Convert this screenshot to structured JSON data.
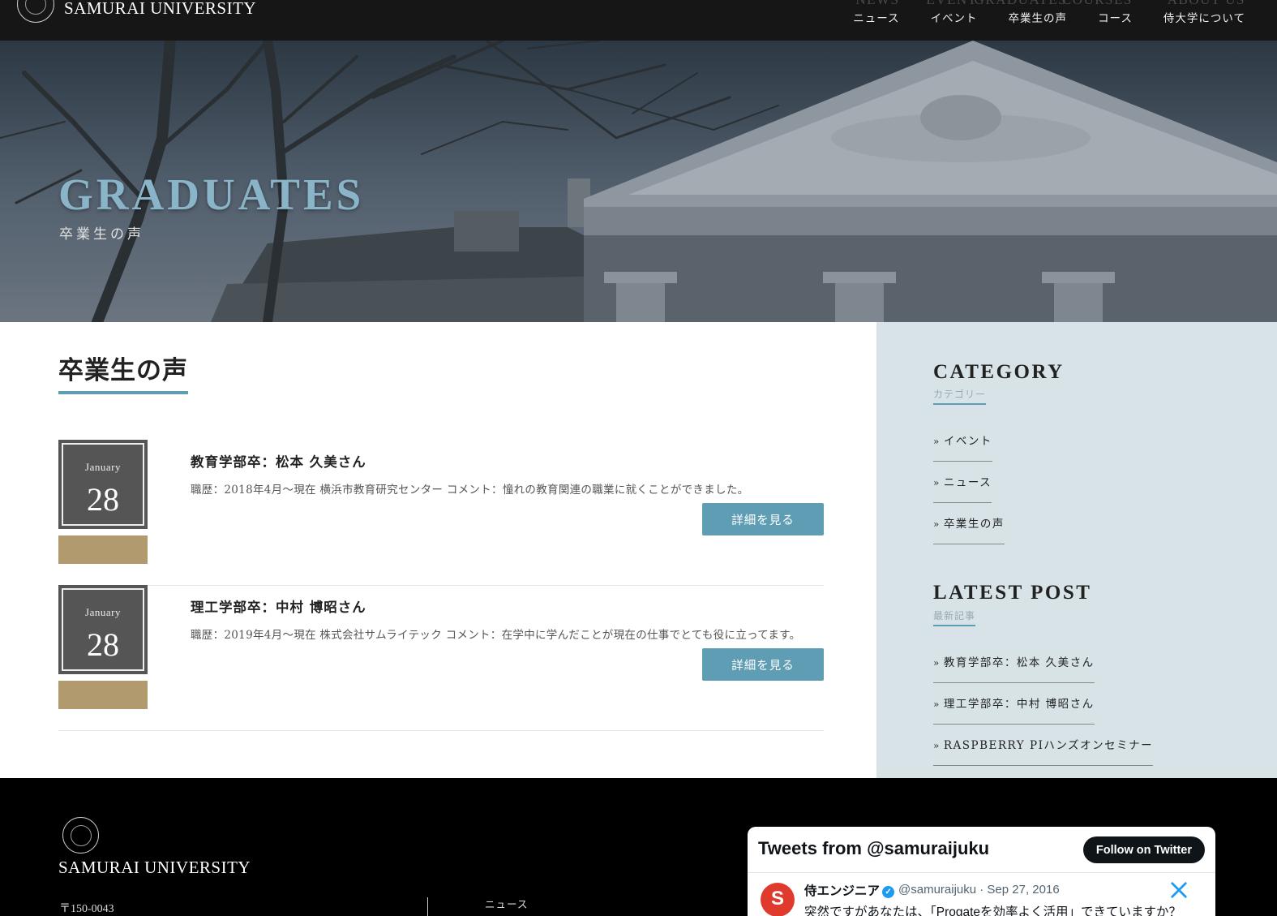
{
  "header": {
    "logo_text": "SAMURAI UNIVERSITY",
    "nav": [
      {
        "en": "NEWS",
        "ja": "ニュース"
      },
      {
        "en": "EVENT",
        "ja": "イベント"
      },
      {
        "en": "GRADUATES",
        "ja": "卒業生の声"
      },
      {
        "en": "COURSES",
        "ja": "コース"
      },
      {
        "en": "ABOUT US",
        "ja": "侍大学について"
      }
    ]
  },
  "hero": {
    "title": "GRADUATES",
    "subtitle": "卒業生の声"
  },
  "main": {
    "heading": "卒業生の声",
    "posts": [
      {
        "month": "January",
        "day": "28",
        "title": "教育学部卒：松本 久美さん",
        "description": "職歴：2018年4月～現在 横浜市教育研究センター コメント：憧れの教育関連の職業に就くことができました。",
        "button": "詳細を見る"
      },
      {
        "month": "January",
        "day": "28",
        "title": "理工学部卒：中村 博昭さん",
        "description": "職歴：2019年4月～現在 株式会社サムライテック コメント：在学中に学んだことが現在の仕事でとても役に立ってます。",
        "button": "詳細を見る"
      }
    ]
  },
  "sidebar": {
    "category": {
      "title": "CATEGORY",
      "subtitle": "カテゴリー",
      "items": [
        "イベント",
        "ニュース",
        "卒業生の声"
      ]
    },
    "latest": {
      "title": "LATEST POST",
      "subtitle": "最新記事",
      "items": [
        "教育学部卒：松本 久美さん",
        "理工学部卒：中村 博昭さん",
        "RASPBERRY PIハンズオンセミナー"
      ]
    }
  },
  "footer": {
    "name": "SAMURAI UNIVERSITY",
    "address": "〒150-0043",
    "link": "ニュース"
  },
  "twitter": {
    "title": "Tweets from @samuraijuku",
    "follow": "Follow on Twitter",
    "name": "侍エンジニア",
    "handle_date": "@samuraijuku · Sep 27, 2016",
    "text": "突然ですがあなたは、「Progateを効率よく活用」できていますか？"
  },
  "colors": {
    "accent": "#5e9db3",
    "tag": "#b09a6e",
    "sidebar_bg": "#d8e3e8",
    "date_box": "#555555"
  }
}
